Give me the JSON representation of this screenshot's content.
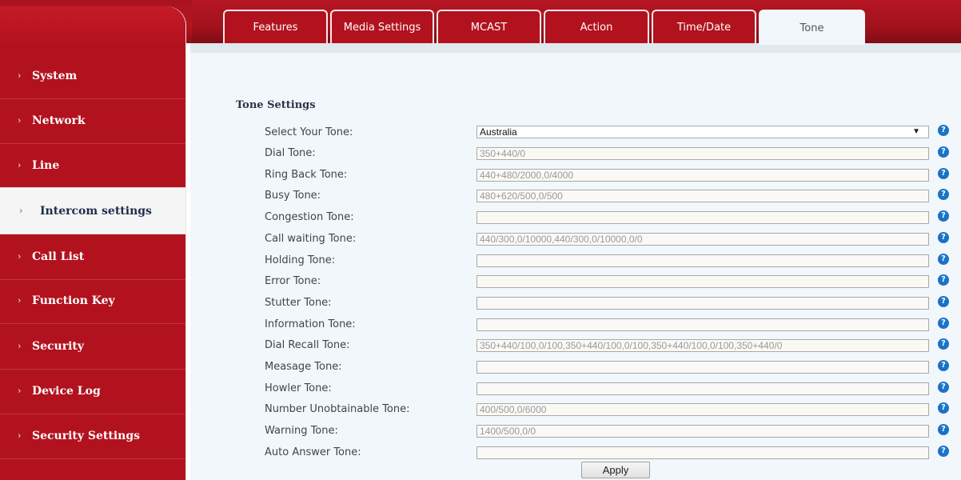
{
  "tabs": [
    {
      "label": "Features"
    },
    {
      "label": "Media Settings"
    },
    {
      "label": "MCAST"
    },
    {
      "label": "Action"
    },
    {
      "label": "Time/Date"
    },
    {
      "label": "Tone",
      "active": true
    }
  ],
  "sidebar": {
    "items": [
      {
        "label": "System"
      },
      {
        "label": "Network"
      },
      {
        "label": "Line"
      },
      {
        "label": "Intercom settings",
        "active": true
      },
      {
        "label": "Call List"
      },
      {
        "label": "Function Key"
      },
      {
        "label": "Security"
      },
      {
        "label": "Device Log"
      },
      {
        "label": "Security Settings"
      }
    ]
  },
  "form": {
    "title": "Tone Settings",
    "select": {
      "label": "Select Your Tone:",
      "value": "Australia"
    },
    "rows": [
      {
        "label": "Dial Tone:",
        "value": "350+440/0"
      },
      {
        "label": "Ring Back Tone:",
        "value": "440+480/2000,0/4000"
      },
      {
        "label": "Busy Tone:",
        "value": "480+620/500,0/500"
      },
      {
        "label": "Congestion Tone:",
        "value": ""
      },
      {
        "label": "Call waiting Tone:",
        "value": "440/300,0/10000,440/300,0/10000,0/0"
      },
      {
        "label": "Holding Tone:",
        "value": ""
      },
      {
        "label": "Error Tone:",
        "value": ""
      },
      {
        "label": "Stutter Tone:",
        "value": ""
      },
      {
        "label": "Information Tone:",
        "value": ""
      },
      {
        "label": "Dial Recall Tone:",
        "value": "350+440/100,0/100,350+440/100,0/100,350+440/100,0/100,350+440/0"
      },
      {
        "label": "Measage Tone:",
        "value": ""
      },
      {
        "label": "Howler Tone:",
        "value": ""
      },
      {
        "label": "Number Unobtainable Tone:",
        "value": "400/500,0/6000"
      },
      {
        "label": "Warning Tone:",
        "value": "1400/500,0/0"
      },
      {
        "label": "Auto Answer Tone:",
        "value": ""
      }
    ],
    "apply_label": "Apply",
    "help_glyph": "?",
    "dropdown_glyph": "▼"
  },
  "colors": {
    "brand_red": "#b2121e",
    "content_bg": "#f1f7fa",
    "help_blue": "#1a73c7"
  }
}
